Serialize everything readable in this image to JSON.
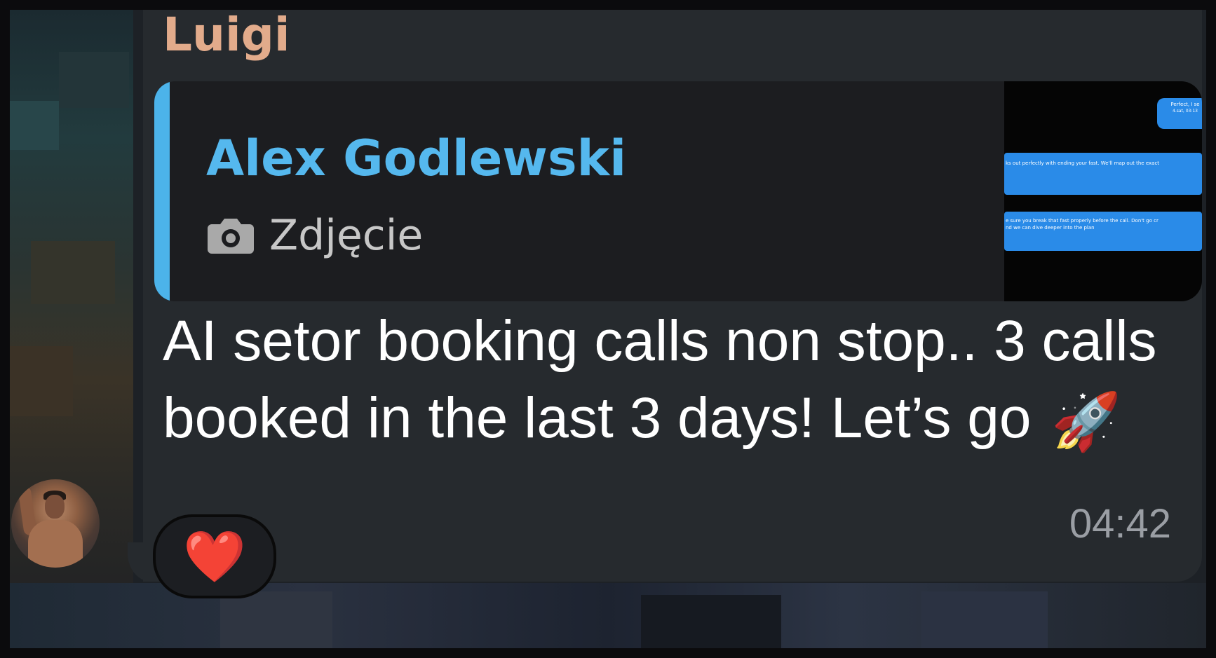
{
  "message": {
    "sender": "Luigi",
    "text": "AI setor booking calls non stop.. 3 calls booked in the last 3 days! Let’s go",
    "emoji": "🚀",
    "time": "04:42",
    "reaction": "❤️",
    "colors": {
      "sender": "#e2ab8b",
      "bubble": "#262a2e",
      "text": "#ffffff",
      "time": "#9a9ea4"
    }
  },
  "reply": {
    "author": "Alex Godlewski",
    "kind": "Zdjęcie",
    "icon": "camera-icon",
    "accent": "#4cb3ea",
    "thumbnail": {
      "bubble1": "Perfect, I se",
      "bubble1_sub": "4.sat, 03:13",
      "bubble2": "ks out perfectly with ending your fast. We'll map out the exact",
      "bubble3_line1": "e sure you break that fast properly before the call. Don't go cr",
      "bubble3_line2": "nd we can dive deeper into the plan"
    }
  }
}
